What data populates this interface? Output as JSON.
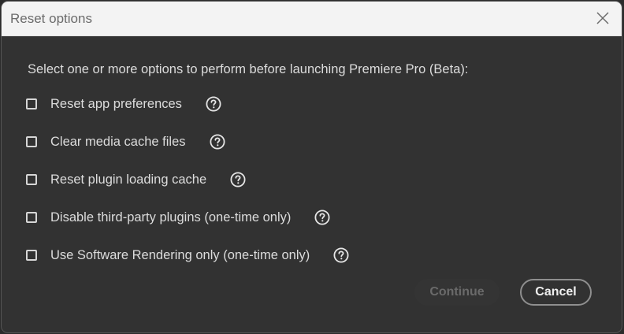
{
  "window": {
    "title": "Reset options",
    "close_icon": "close-icon"
  },
  "dialog": {
    "prompt": "Select one or more options to perform before launching Premiere Pro (Beta):",
    "options": [
      {
        "label": "Reset app preferences",
        "checked": false,
        "help_icon": "question-circle-icon"
      },
      {
        "label": "Clear media cache files",
        "checked": false,
        "help_icon": "question-circle-icon"
      },
      {
        "label": "Reset plugin loading cache",
        "checked": false,
        "help_icon": "question-circle-icon"
      },
      {
        "label": "Disable third-party plugins (one-time only)",
        "checked": false,
        "help_icon": "question-circle-icon"
      },
      {
        "label": "Use Software Rendering only (one-time only)",
        "checked": false,
        "help_icon": "question-circle-icon"
      }
    ]
  },
  "buttons": {
    "continue_label": "Continue",
    "continue_enabled": false,
    "cancel_label": "Cancel"
  },
  "colors": {
    "dialog_bg": "#323232",
    "titlebar_bg": "#f3f3f3",
    "text": "#dcdcdc",
    "disabled_text": "#6a6a6a"
  }
}
